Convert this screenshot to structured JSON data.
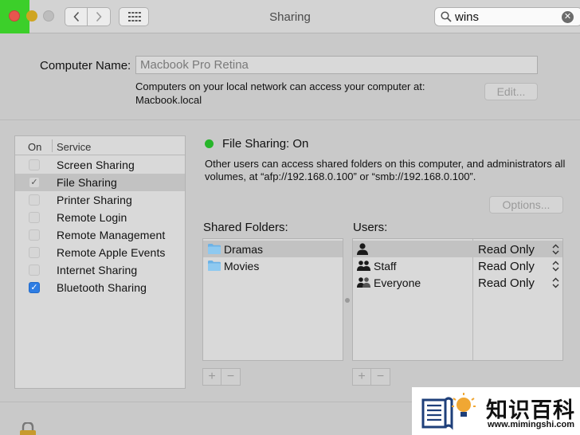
{
  "window": {
    "title": "Sharing"
  },
  "search": {
    "value": "wins"
  },
  "computer_name": {
    "label": "Computer Name:",
    "value": "Macbook Pro Retina",
    "description_line1": "Computers on your local network can access your computer at:",
    "description_line2": "Macbook.local",
    "edit_label": "Edit..."
  },
  "services": {
    "header_on": "On",
    "header_service": "Service",
    "items": [
      {
        "label": "Screen Sharing",
        "checked": false
      },
      {
        "label": "File Sharing",
        "checked": true,
        "selected": true
      },
      {
        "label": "Printer Sharing",
        "checked": false
      },
      {
        "label": "Remote Login",
        "checked": false
      },
      {
        "label": "Remote Management",
        "checked": false
      },
      {
        "label": "Remote Apple Events",
        "checked": false
      },
      {
        "label": "Internet Sharing",
        "checked": false
      },
      {
        "label": "Bluetooth Sharing",
        "checked": true
      }
    ]
  },
  "file_sharing": {
    "status": "File Sharing: On",
    "status_color": "#27b52a",
    "description": "Other users can access shared folders on this computer, and administrators all volumes, at “afp://192.168.0.100” or “smb://192.168.0.100”.",
    "options_label": "Options..."
  },
  "shared_folders": {
    "title": "Shared Folders:",
    "items": [
      {
        "label": "Dramas",
        "icon": "folder-icon",
        "selected": true
      },
      {
        "label": "Movies",
        "icon": "folder-icon"
      }
    ]
  },
  "users": {
    "title": "Users:",
    "items": [
      {
        "label": "",
        "icon": "user-icon",
        "permission": "Read Only"
      },
      {
        "label": "Staff",
        "icon": "group-icon",
        "permission": "Read Only"
      },
      {
        "label": "Everyone",
        "icon": "group-icon",
        "permission": "Read Only"
      }
    ]
  },
  "controls": {
    "add": "+",
    "remove": "−"
  },
  "watermark": {
    "title": "知识百科",
    "url": "www.mimingshi.com"
  },
  "colors": {
    "highlight": "#3ccf2a",
    "close": "#e8554e",
    "checkbox_blue": "#2e7de3"
  }
}
